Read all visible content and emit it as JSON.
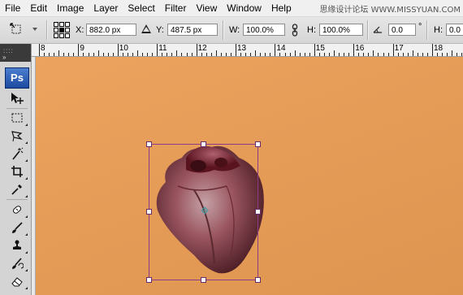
{
  "menu": {
    "items": [
      "File",
      "Edit",
      "Image",
      "Layer",
      "Select",
      "Filter",
      "View",
      "Window",
      "Help"
    ]
  },
  "watermark": "思缘设计论坛  WWW.MISSYUAN.COM",
  "options": {
    "x_label": "X:",
    "x_value": "882.0 px",
    "y_label": "Y:",
    "y_value": "487.5 px",
    "w_label": "W:",
    "w_value": "100.0%",
    "h_label": "H:",
    "h_value": "100.0%",
    "angle_value": "0.0",
    "degree_symbol": "°",
    "h2_label": "H:",
    "h2_value": "0.0"
  },
  "tools": {
    "logo": "Ps",
    "icons": [
      "move-tool",
      "marquee-tool",
      "lasso-tool",
      "magic-wand-tool",
      "crop-tool",
      "eyedropper-tool",
      "healing-brush-tool",
      "brush-tool",
      "clone-stamp-tool",
      "history-brush-tool",
      "eraser-tool"
    ]
  },
  "ruler": {
    "labels": [
      "8",
      "9",
      "10",
      "11",
      "12",
      "13",
      "14",
      "15",
      "16",
      "17",
      "18"
    ]
  },
  "colors": {
    "canvas": "#e49c57",
    "transform_box": "#8e3a8a",
    "ps_logo": "#2a5cb6"
  }
}
